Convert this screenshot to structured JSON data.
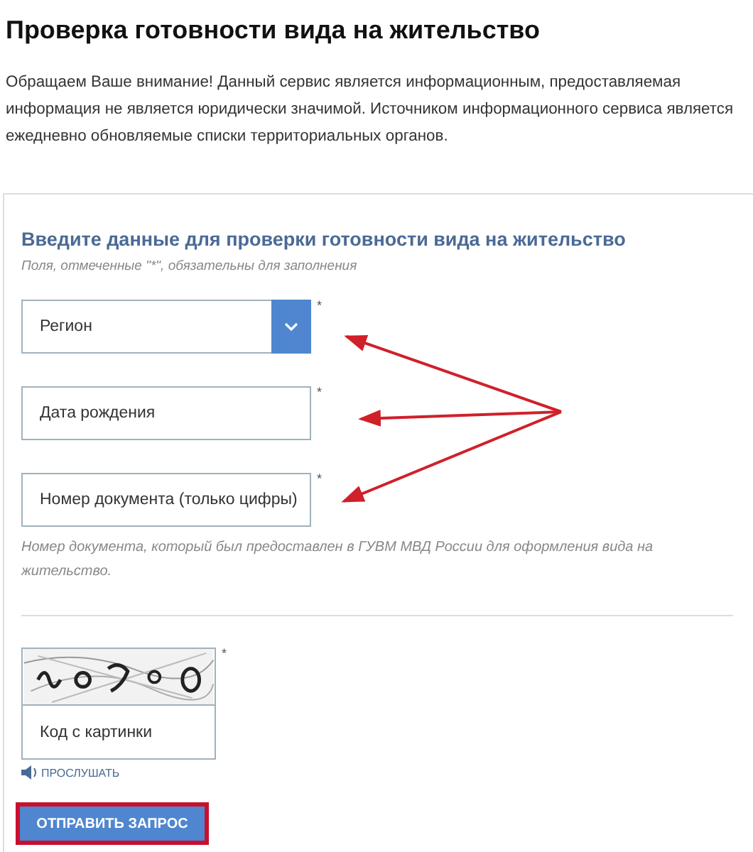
{
  "title": "Проверка готовности вида на жительство",
  "notice": "Обращаем Ваше внимание! Данный сервис является информационным, предоставляемая информация не является юридически значимой. Источником информационного сервиса является ежедневно обновляемые списки территориальных органов.",
  "form": {
    "heading": "Введите данные для проверки готовности вида на жительство",
    "required_note": "Поля, отмеченные \"*\", обязательны для заполнения",
    "fields": [
      {
        "kind": "select",
        "placeholder": "Регион",
        "mark": "*"
      },
      {
        "kind": "text",
        "placeholder": "Дата рождения",
        "mark": "*"
      },
      {
        "kind": "text",
        "placeholder": "Номер документа (только цифры)",
        "mark": "*"
      }
    ],
    "hint": "Номер документа, который был предоставлен в ГУВМ МВД России для оформления вида на жительство.",
    "captcha": {
      "placeholder": "Код с картинки",
      "mark": "*",
      "listen": "ПРОСЛУШАТЬ"
    },
    "submit": {
      "label": "ОТПРАВИТЬ ЗАПРОС",
      "highlighted": true
    }
  }
}
